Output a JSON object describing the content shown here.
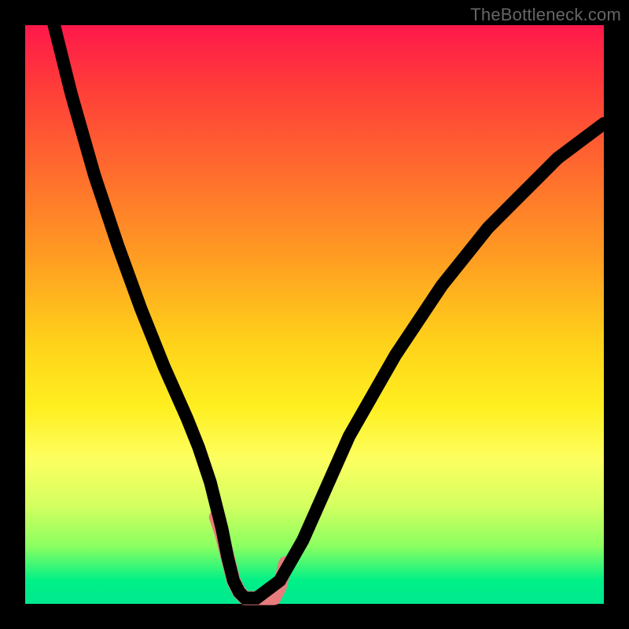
{
  "watermark": "TheBottleneck.com",
  "chart_data": {
    "type": "line",
    "title": "",
    "xlabel": "",
    "ylabel": "",
    "xlim": [
      0,
      100
    ],
    "ylim": [
      0,
      100
    ],
    "series": [
      {
        "name": "bottleneck-curve",
        "x": [
          4,
          8,
          12,
          16,
          20,
          24,
          28,
          30,
          32,
          34,
          35,
          36,
          37,
          38,
          40,
          44,
          48,
          52,
          56,
          60,
          64,
          68,
          72,
          76,
          80,
          84,
          88,
          92,
          96,
          100
        ],
        "values": [
          104,
          88,
          74,
          62,
          51,
          41,
          32,
          27,
          21,
          13,
          8,
          4,
          2,
          1,
          1,
          4,
          11,
          20,
          29,
          36,
          43,
          49,
          55,
          60,
          65,
          69,
          73,
          77,
          80,
          83
        ]
      }
    ],
    "overlay_highlight": {
      "name": "optimal-range",
      "color": "#e77c7c",
      "x": [
        33,
        34,
        35,
        36,
        37,
        38,
        39,
        40,
        41,
        42,
        43,
        44,
        45
      ],
      "values": [
        15,
        12,
        8,
        4,
        2,
        1,
        1,
        1,
        1,
        1,
        1,
        3,
        7
      ]
    },
    "gradient_stops": [
      {
        "pos": 0.0,
        "color": "#ff184b"
      },
      {
        "pos": 0.4,
        "color": "#ff9c22"
      },
      {
        "pos": 0.66,
        "color": "#ffef20"
      },
      {
        "pos": 0.9,
        "color": "#8cff60"
      },
      {
        "pos": 1.0,
        "color": "#00e890"
      }
    ],
    "grid": false,
    "legend": false
  }
}
